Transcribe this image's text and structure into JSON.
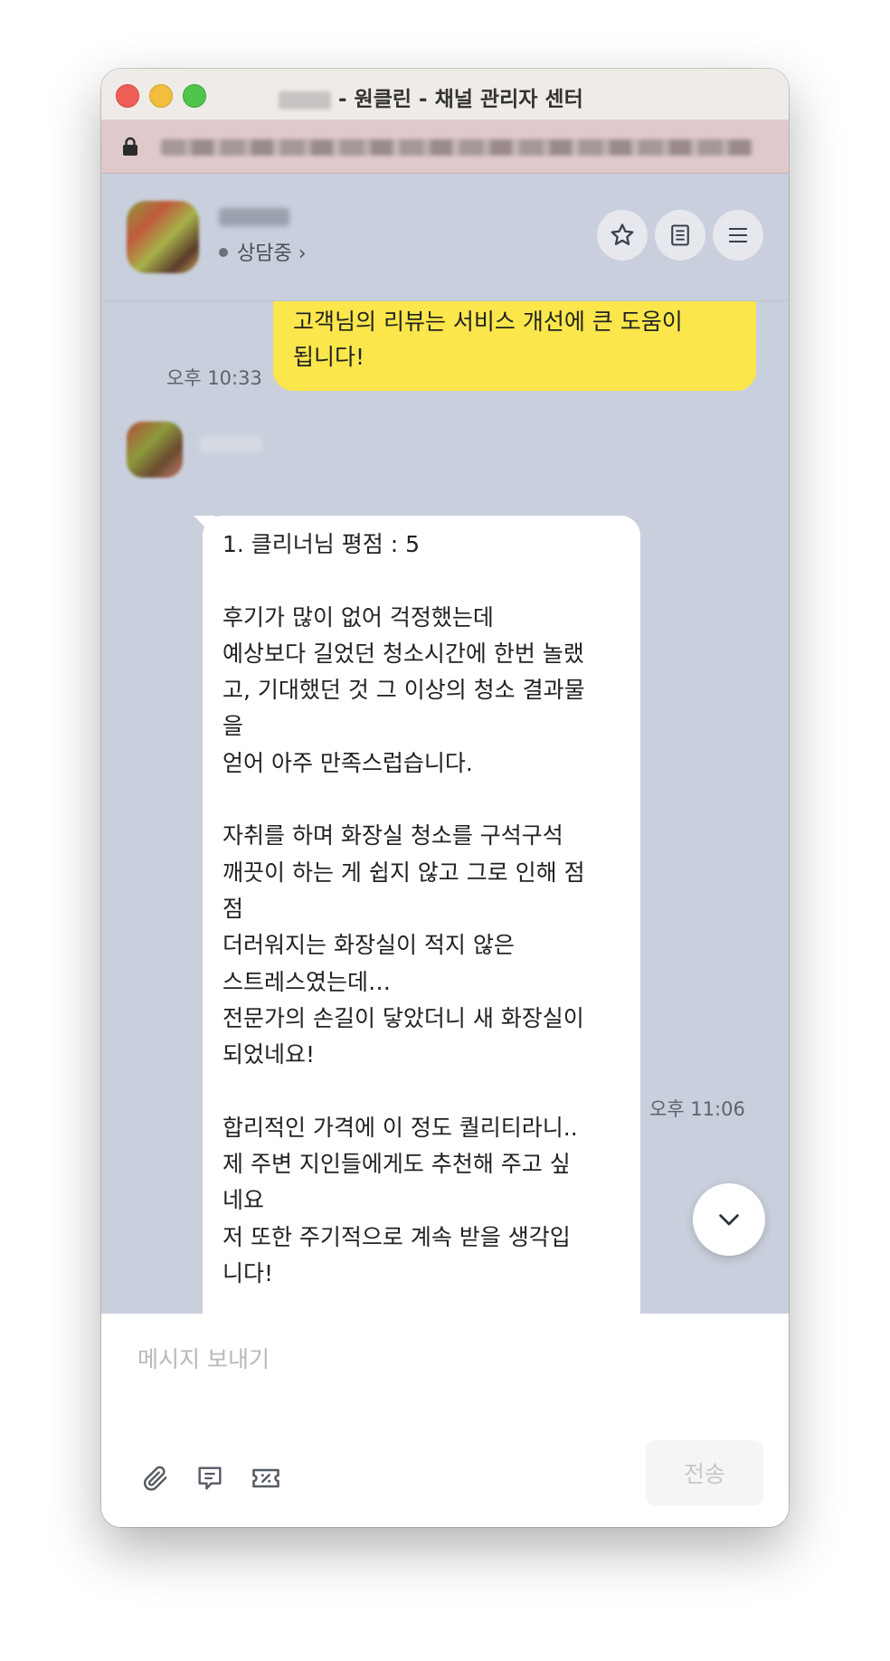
{
  "window": {
    "title_suffix": " - 원클린 - 채널 관리자 센터"
  },
  "chat_header": {
    "status_label": "상담중 ›",
    "icons": [
      "star-icon",
      "memo-icon",
      "menu-icon"
    ]
  },
  "messages": {
    "sent": {
      "text": "고객님의 리뷰는 서비스 개선에 큰 도움이\n됩니다!",
      "time": "오후 10:33"
    },
    "received": {
      "text": "1. 클리너님 평점 : 5\n\n후기가 많이 없어 걱정했는데\n예상보다 길었던 청소시간에 한번 놀랬\n고, 기대했던 것 그 이상의 청소 결과물\n을\n얻어 아주 만족스럽습니다.\n\n자취를 하며 화장실 청소를 구석구석\n깨끗이 하는 게 쉽지 않고 그로 인해 점\n점\n더러워지는 화장실이 적지 않은\n스트레스였는데…\n전문가의 손길이 닿았더니 새 화장실이\n되었네요!\n\n합리적인 가격에 이 정도 퀄리티라니..\n제 주변 지인들에게도 추천해 주고 싶\n네요\n저 또한 주기적으로 계속 받을 생각입\n니다!\n\n가성비 짱짱!! 정말 추천합니다!",
      "time": "오후 11:06"
    }
  },
  "composer": {
    "placeholder": "메시지 보내기",
    "send_label": "전송"
  },
  "colors": {
    "chat_background": "#c9cfdc",
    "sent_bubble": "#fbe74b",
    "received_bubble": "#ffffff",
    "url_bar": "#dfc9ca"
  }
}
